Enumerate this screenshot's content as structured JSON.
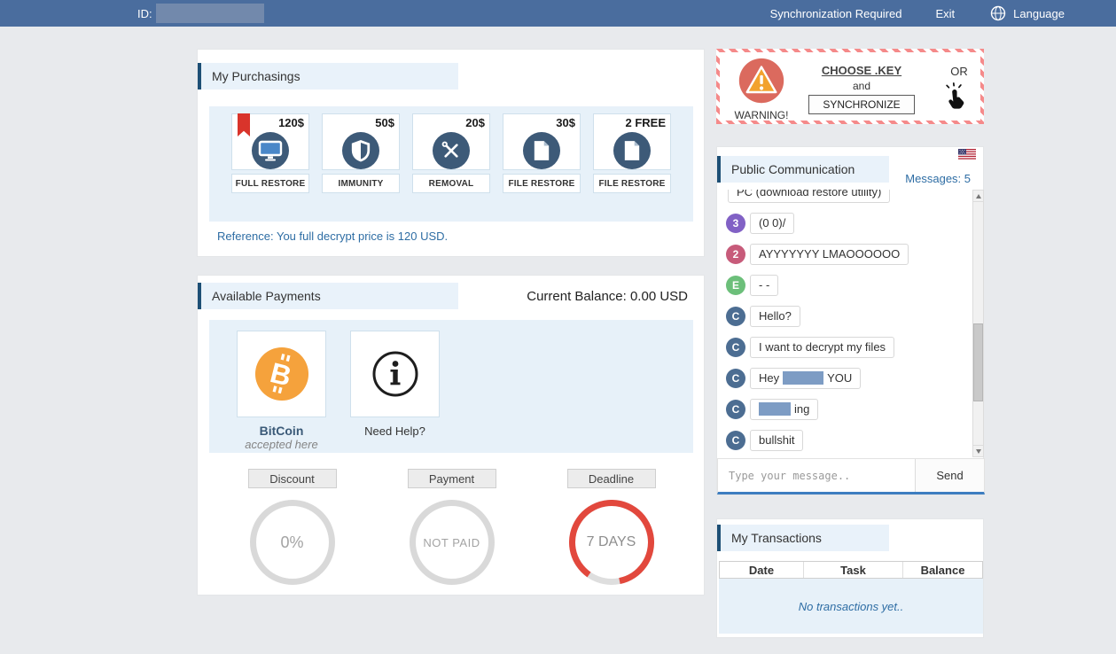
{
  "topbar": {
    "id_label": "ID:",
    "sync_required": "Synchronization Required",
    "exit_label": "Exit",
    "language_label": "Language"
  },
  "purchasings": {
    "title": "My Purchasings",
    "products": [
      {
        "price": "120$",
        "label": "FULL RESTORE",
        "icon": "monitor-icon",
        "featured": true
      },
      {
        "price": "50$",
        "label": "IMMUNITY",
        "icon": "shield-icon"
      },
      {
        "price": "20$",
        "label": "REMOVAL",
        "icon": "tools-icon"
      },
      {
        "price": "30$",
        "label": "FILE RESTORE",
        "icon": "file-icon"
      },
      {
        "price": "2 FREE",
        "label": "FILE RESTORE",
        "icon": "file-icon"
      }
    ],
    "reference": "Reference: You full decrypt price is 120 USD."
  },
  "payments": {
    "title": "Available Payments",
    "balance": "Current Balance: 0.00 USD",
    "bitcoin_name": "BitCoin",
    "bitcoin_sub": "accepted here",
    "help_label": "Need Help?",
    "gauges": [
      {
        "label": "Discount",
        "value": "0%"
      },
      {
        "label": "Payment",
        "value": "NOT PAID"
      },
      {
        "label": "Deadline",
        "value": "7 DAYS"
      }
    ]
  },
  "warning": {
    "label": "WARNING!",
    "choose_key": "CHOOSE .KEY",
    "and_text": "and",
    "synchronize": "SYNCHRONIZE",
    "or_text": "OR"
  },
  "chat": {
    "title": "Public Communication",
    "messages_count": "Messages: 5",
    "placeholder": "Type your message..",
    "send": "Send",
    "messages": [
      {
        "text": "PC (download restore utility)"
      },
      {
        "avatar": "3",
        "color": "#8161c5",
        "text": "(0 0)/"
      },
      {
        "avatar": "2",
        "color": "#c75b7a",
        "text": "AYYYYYYY LMAOOOOOO"
      },
      {
        "avatar": "E",
        "color": "#6cbf7a",
        "text": "- -"
      },
      {
        "avatar": "C",
        "color": "#4c6d92",
        "text": "Hello?"
      },
      {
        "avatar": "C",
        "color": "#4c6d92",
        "text": "I want to decrypt my files"
      },
      {
        "avatar": "C",
        "color": "#4c6d92",
        "text_before": "Hey",
        "text_after": "YOU",
        "redacted": true
      },
      {
        "avatar": "C",
        "color": "#4c6d92",
        "text_after": "ing",
        "redacted": true
      },
      {
        "avatar": "C",
        "color": "#4c6d92",
        "text": "bullshit"
      }
    ]
  },
  "transactions": {
    "title": "My Transactions",
    "col_date": "Date",
    "col_task": "Task",
    "col_balance": "Balance",
    "empty": "No transactions yet.."
  },
  "colors": {
    "topbar_blue": "#4a6d9e",
    "accent_blue": "#1d4f75",
    "panel_blue": "#e7f1f9",
    "link_blue": "#2e6da4",
    "bitcoin_orange": "#f5a23c",
    "warning_red": "#db6a5e",
    "deadline_red": "#e2483d",
    "icon_slate": "#3d5a78",
    "redaction_blue": "#7d9cc4"
  }
}
